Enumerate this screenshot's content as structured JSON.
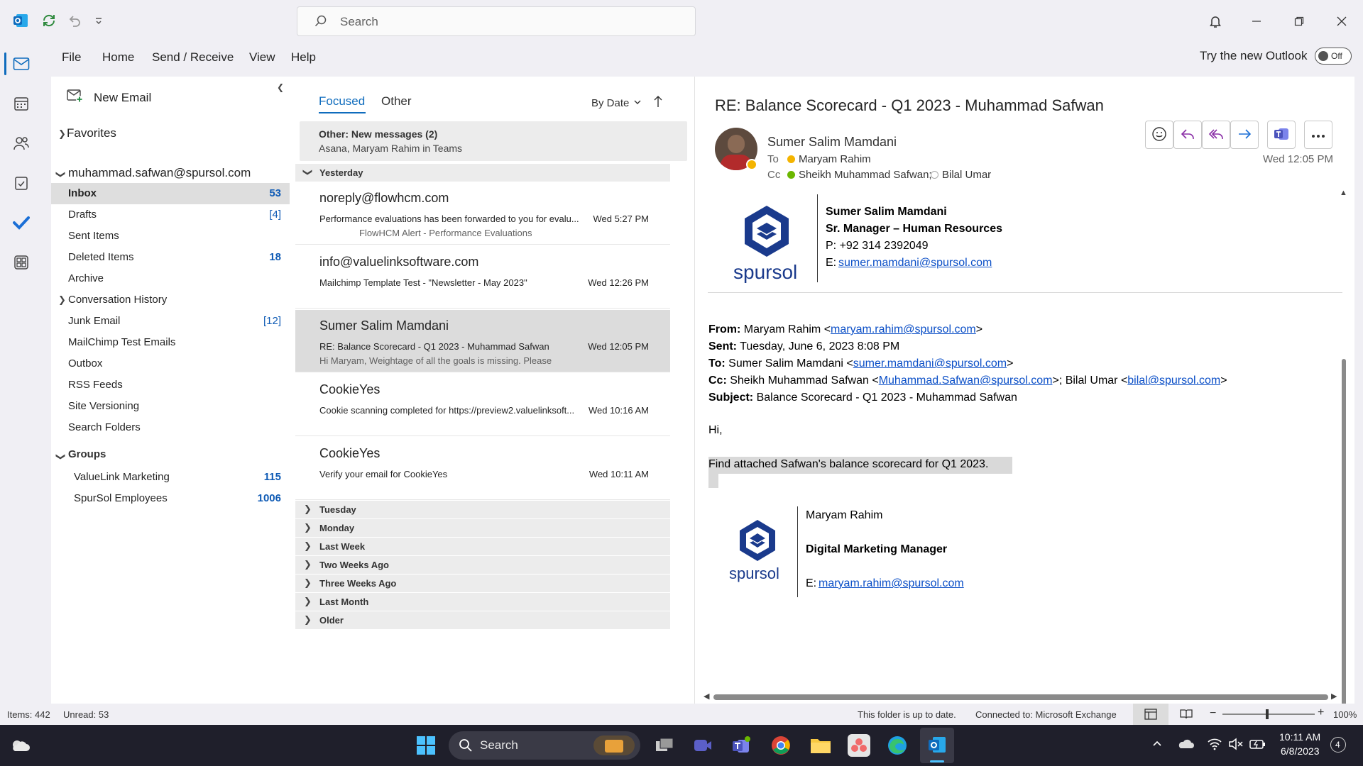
{
  "search": {
    "placeholder": "Search"
  },
  "menu": {
    "file": "File",
    "home": "Home",
    "send_receive": "Send / Receive",
    "view": "View",
    "help": "Help"
  },
  "try_new": {
    "label": "Try the new Outlook",
    "toggle": "Off"
  },
  "folders": {
    "new_email": "New Email",
    "favorites": "Favorites",
    "account": "muhammad.safwan@spursol.com",
    "items": [
      {
        "label": "Inbox",
        "count": "53"
      },
      {
        "label": "Drafts",
        "count": "[4]"
      },
      {
        "label": "Sent Items",
        "count": ""
      },
      {
        "label": "Deleted Items",
        "count": "18"
      },
      {
        "label": "Archive",
        "count": ""
      },
      {
        "label": "Conversation History",
        "count": ""
      },
      {
        "label": "Junk Email",
        "count": "[12]"
      },
      {
        "label": "MailChimp Test Emails",
        "count": ""
      },
      {
        "label": "Outbox",
        "count": ""
      },
      {
        "label": "RSS Feeds",
        "count": ""
      },
      {
        "label": "Site Versioning",
        "count": ""
      },
      {
        "label": "Search Folders",
        "count": ""
      }
    ],
    "groups_label": "Groups",
    "groups": [
      {
        "label": "ValueLink Marketing",
        "count": "115"
      },
      {
        "label": "SpurSol Employees",
        "count": "1006"
      }
    ]
  },
  "list": {
    "tabs": {
      "focused": "Focused",
      "other": "Other"
    },
    "sort": "By Date",
    "other_banner": {
      "title": "Other: New messages (2)",
      "detail": "Asana, Maryam Rahim in Teams"
    },
    "yesterday": "Yesterday",
    "messages": [
      {
        "from": "noreply@flowhcm.com",
        "subject": "Performance evaluations has been forwarded to you for evalu...",
        "preview": "FlowHCM Alert - Performance Evaluations",
        "time": "Wed 5:27 PM"
      },
      {
        "from": "info@valuelinksoftware.com",
        "subject": "Mailchimp Template Test - \"Newsletter - May 2023\"",
        "preview": "",
        "time": "Wed 12:26 PM"
      },
      {
        "from": "Sumer Salim Mamdani",
        "subject": "RE: Balance Scorecard - Q1 2023 - Muhammad Safwan",
        "preview": "Hi Maryam,  Weightage of all the goals is missing. Please",
        "time": "Wed 12:05 PM"
      },
      {
        "from": "CookieYes",
        "subject": "Cookie scanning completed  for https://preview2.valuelinksoft...",
        "preview": "",
        "time": "Wed 10:16 AM"
      },
      {
        "from": "CookieYes",
        "subject": "Verify your email for CookieYes",
        "preview": "",
        "time": "Wed 10:11 AM"
      }
    ],
    "groups": [
      "Tuesday",
      "Monday",
      "Last Week",
      "Two Weeks Ago",
      "Three Weeks Ago",
      "Last Month",
      "Older"
    ]
  },
  "reading": {
    "subject": "RE: Balance Scorecard - Q1 2023 - Muhammad Safwan",
    "sender": "Sumer Salim Mamdani",
    "to_label": "To",
    "to": "Maryam Rahim",
    "cc_label": "Cc",
    "cc1": "Sheikh Muhammad Safwan;",
    "cc2": "Bilal Umar",
    "time": "Wed 12:05 PM",
    "sig1": {
      "logo": "spursol",
      "name": "Sumer Salim Mamdani",
      "title": "Sr. Manager – Human Resources",
      "phone": "P: +92 314 2392049",
      "email_label": "E:",
      "email": "sumer.mamdani@spursol.com"
    },
    "quoted": {
      "from_label": "From:",
      "from_name": "Maryam Rahim <",
      "from_email": "maryam.rahim@spursol.com",
      "from_end": ">",
      "sent_label": "Sent:",
      "sent": "Tuesday, June 6, 2023 8:08 PM",
      "to_label": "To:",
      "to_name": "Sumer Salim Mamdani <",
      "to_email": "sumer.mamdani@spursol.com",
      "to_end": ">",
      "cc_label": "Cc:",
      "cc_name1": "Sheikh Muhammad Safwan <",
      "cc_email1": "Muhammad.Safwan@spursol.com",
      "cc_mid": ">; Bilal Umar <",
      "cc_email2": "bilal@spursol.com",
      "cc_end": ">",
      "subject_label": "Subject:",
      "subject": "Balance Scorecard - Q1 2023 - Muhammad Safwan",
      "greeting": "Hi,",
      "body": "Find attached Safwan's balance scorecard for Q1 2023."
    },
    "sig2": {
      "logo": "spursol",
      "name": "Maryam Rahim",
      "title": "Digital Marketing Manager",
      "email_label": "E:",
      "email": "maryam.rahim@spursol.com"
    }
  },
  "status": {
    "items": "Items: 442",
    "unread": "Unread: 53",
    "sync": "This folder is up to date.",
    "connected": "Connected to: Microsoft Exchange",
    "zoom": "100%"
  },
  "taskbar": {
    "search": "Search",
    "time": "10:11 AM",
    "date": "6/8/2023",
    "notif": "4"
  },
  "colors": {
    "accent": "#0f6cbd",
    "brand_blue": "#1a3a8c",
    "link": "#0b4fc7"
  }
}
